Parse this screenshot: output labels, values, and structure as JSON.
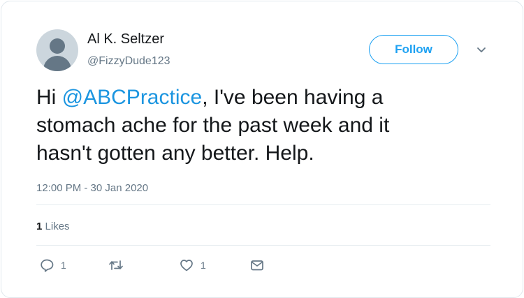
{
  "user": {
    "name": "Al K. Seltzer",
    "handle": "@FizzyDude123"
  },
  "follow_label": "Follow",
  "tweet": {
    "prefix": "Hi ",
    "mention": "@ABCPractice",
    "line1_rest": ", I've been having a",
    "line2": "stomach ache for the past week and it",
    "line3": "hasn't gotten any better. Help."
  },
  "timestamp": "12:00 PM - 30 Jan 2020",
  "stats": {
    "likes_count": "1",
    "likes_label": "Likes"
  },
  "actions": {
    "reply_count": "1",
    "like_count": "1"
  },
  "icons": [
    "avatar-placeholder",
    "chevron-down-icon",
    "reply-icon",
    "retweet-icon",
    "heart-icon",
    "envelope-icon"
  ],
  "colors": {
    "accent": "#1da1f2",
    "mention": "#1b95e0",
    "secondary_text": "#657786",
    "border": "#e1e8ed"
  }
}
